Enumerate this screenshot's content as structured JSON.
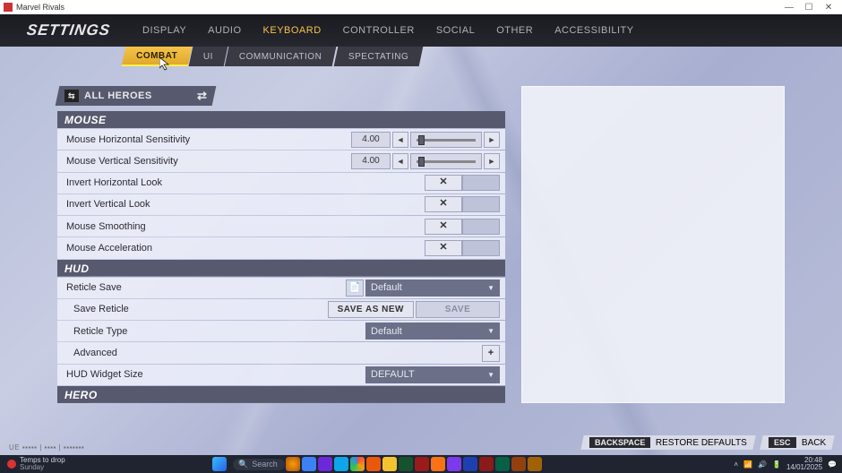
{
  "window": {
    "title": "Marvel Rivals"
  },
  "header": {
    "title": "SETTINGS",
    "tabs": [
      "DISPLAY",
      "AUDIO",
      "KEYBOARD",
      "CONTROLLER",
      "SOCIAL",
      "OTHER",
      "ACCESSIBILITY"
    ],
    "active_tab": "KEYBOARD"
  },
  "subtabs": {
    "items": [
      "COMBAT",
      "UI",
      "COMMUNICATION",
      "SPECTATING"
    ],
    "active": "COMBAT"
  },
  "hero_selector": {
    "label": "ALL HEROES"
  },
  "sections": {
    "mouse": {
      "title": "MOUSE",
      "hsens": {
        "label": "Mouse Horizontal Sensitivity",
        "value": "4.00"
      },
      "vsens": {
        "label": "Mouse Vertical Sensitivity",
        "value": "4.00"
      },
      "invh": {
        "label": "Invert Horizontal Look",
        "state": "✕"
      },
      "invv": {
        "label": "Invert Vertical Look",
        "state": "✕"
      },
      "smooth": {
        "label": "Mouse Smoothing",
        "state": "✕"
      },
      "accel": {
        "label": "Mouse Acceleration",
        "state": "✕"
      }
    },
    "hud": {
      "title": "HUD",
      "reticle_save": {
        "label": "Reticle Save",
        "value": "Default"
      },
      "save_reticle": {
        "label": "Save Reticle",
        "save_as_new": "SAVE AS NEW",
        "save": "SAVE"
      },
      "reticle_type": {
        "label": "Reticle Type",
        "value": "Default"
      },
      "advanced": {
        "label": "Advanced"
      },
      "widget": {
        "label": "HUD Widget Size",
        "value": "DEFAULT"
      }
    },
    "hero": {
      "title": "HERO"
    }
  },
  "footer": {
    "restore": {
      "key": "BACKSPACE",
      "label": "RESTORE DEFAULTS"
    },
    "back": {
      "key": "ESC",
      "label": "BACK"
    }
  },
  "taskbar": {
    "search_placeholder": "Search",
    "weather": {
      "line1": "Temps to drop",
      "line2": "Sunday"
    },
    "time": "20:48",
    "date": "14/01/2025"
  }
}
